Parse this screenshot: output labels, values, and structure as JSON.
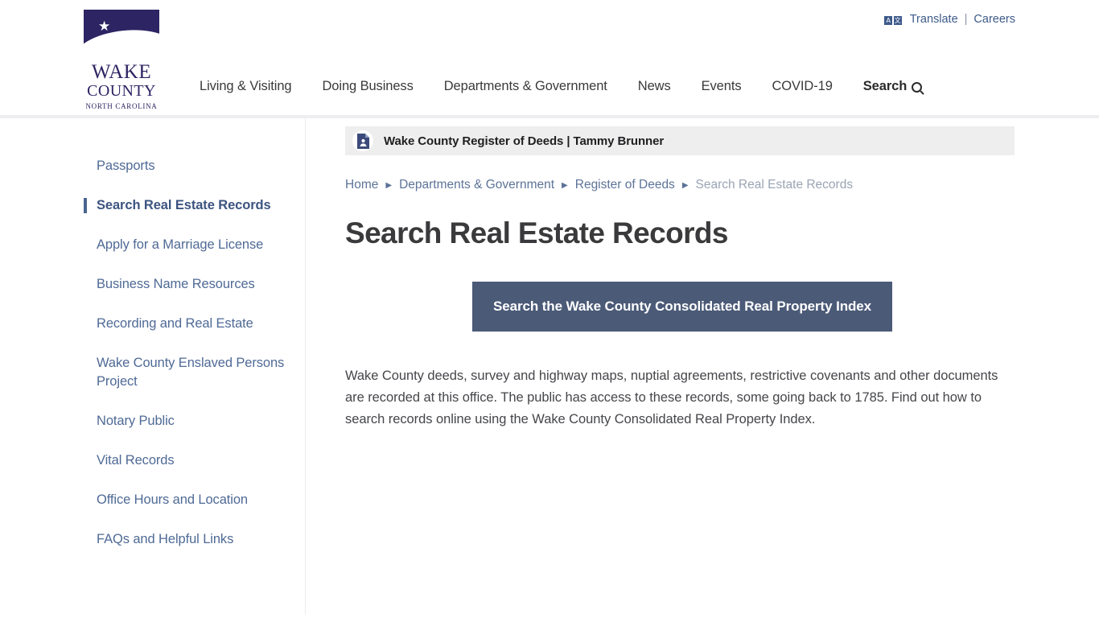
{
  "header": {
    "logo": {
      "line1": "WAKE",
      "line2": "COUNTY",
      "line3": "NORTH CAROLINA",
      "star_glyph": "★",
      "navy": "#2d2463",
      "tan": "#9b7950"
    },
    "utility": {
      "translate_label": "Translate",
      "translate_icon_a": "A",
      "translate_icon_b": "文",
      "separator": "|",
      "careers_label": "Careers"
    },
    "nav": [
      {
        "label": "Living & Visiting"
      },
      {
        "label": "Doing Business"
      },
      {
        "label": "Departments & Government"
      },
      {
        "label": "News"
      },
      {
        "label": "Events"
      },
      {
        "label": "COVID-19"
      },
      {
        "label": "Search"
      }
    ]
  },
  "sidebar": {
    "items": [
      {
        "label": "Passports",
        "active": false
      },
      {
        "label": "Search Real Estate Records",
        "active": true
      },
      {
        "label": "Apply for a Marriage License",
        "active": false
      },
      {
        "label": "Business Name Resources",
        "active": false
      },
      {
        "label": "Recording and Real Estate",
        "active": false
      },
      {
        "label": "Wake County Enslaved Persons Project",
        "active": false
      },
      {
        "label": "Notary Public",
        "active": false
      },
      {
        "label": "Vital Records",
        "active": false
      },
      {
        "label": "Office Hours and Location",
        "active": false
      },
      {
        "label": "FAQs and Helpful Links",
        "active": false
      }
    ]
  },
  "main": {
    "department_banner": {
      "title": "Wake County Register of Deeds | Tammy Brunner",
      "icon": "document-person-icon",
      "background": "#eeeeee"
    },
    "breadcrumb": {
      "separator": "▶",
      "items": [
        {
          "label": "Home",
          "current": false
        },
        {
          "label": "Departments & Government",
          "current": false
        },
        {
          "label": "Register of Deeds",
          "current": false
        },
        {
          "label": "Search Real Estate Records",
          "current": true
        }
      ]
    },
    "page_title": "Search Real Estate Records",
    "cta": {
      "label": "Search the Wake County Consolidated Real Property Index",
      "color": "#4b5a77"
    },
    "body_paragraph": "Wake County deeds, survey and highway maps, nuptial agreements, restrictive covenants and other documents are recorded at this office. The public has access to these records, some going back to 1785. Find out how to search records online using the Wake County Consolidated Real Property Index."
  }
}
